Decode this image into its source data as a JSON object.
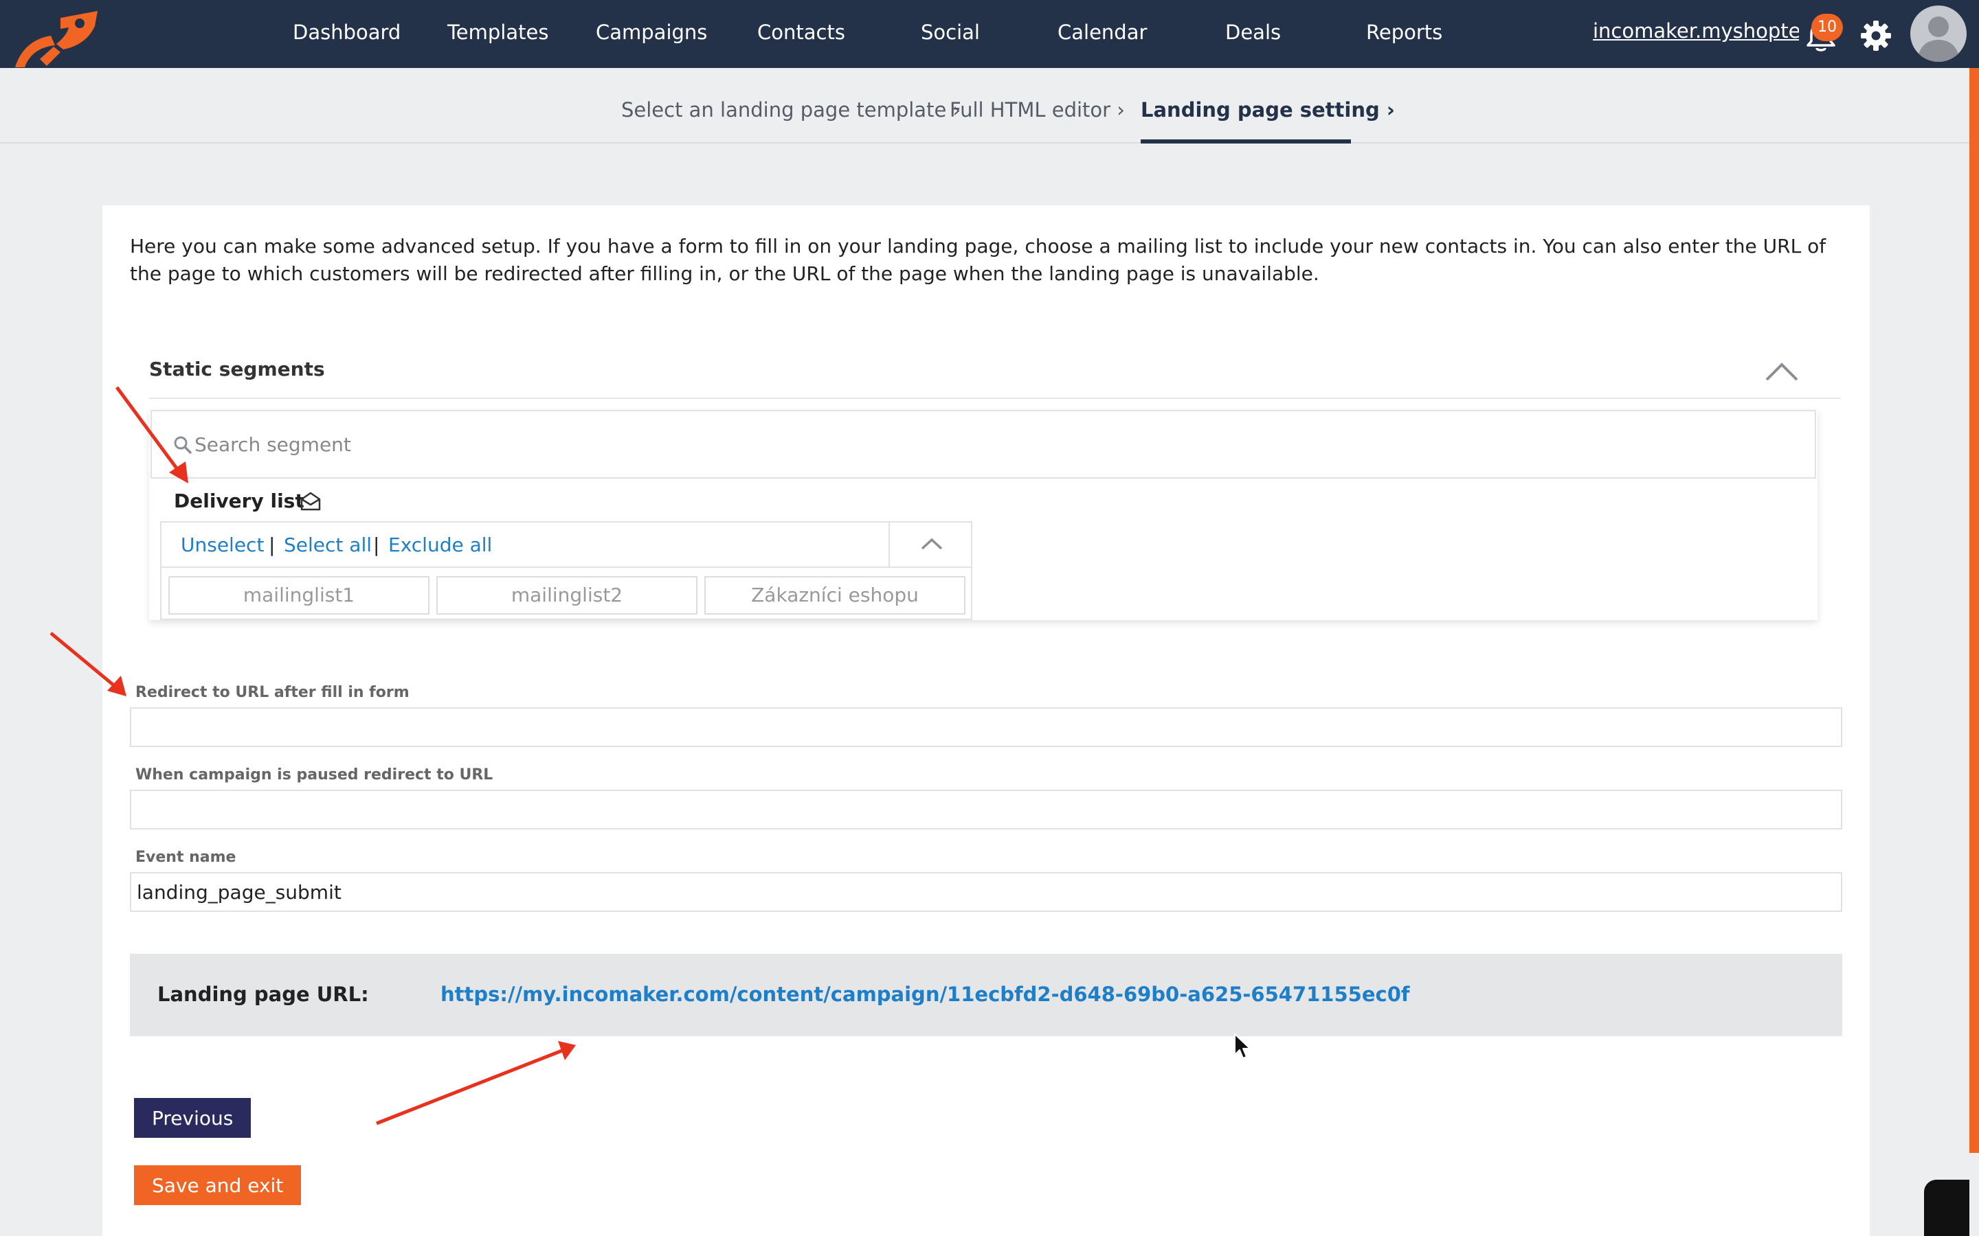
{
  "nav": {
    "items": [
      "Dashboard",
      "Templates",
      "Campaigns",
      "Contacts",
      "Social",
      "Calendar",
      "Deals",
      "Reports"
    ],
    "account": "incomaker.myshopte...",
    "notifications_count": "10"
  },
  "steps": [
    {
      "label": "Select an landing page template",
      "active": false
    },
    {
      "label": "Full HTML editor",
      "active": false
    },
    {
      "label": "Landing page setting",
      "active": true
    }
  ],
  "intro": "Here you can make some advanced setup. If you have a form to fill in on your landing page, choose a mailing list to include your new contacts in. You can also enter the URL of the page to which customers will be redirected after filling in, or the URL of the page when the landing page is unavailable.",
  "segments": {
    "title": "Static segments",
    "search_placeholder": "Search segment",
    "delivery_list_label": "Delivery list",
    "actions": {
      "unselect": "Unselect",
      "select_all": "Select all",
      "exclude_all": "Exclude all",
      "separator": "|"
    },
    "lists": [
      "mailinglist1",
      "mailinglist2",
      "Zákazníci eshopu"
    ]
  },
  "fields": {
    "redirect_label": "Redirect to URL after fill in form",
    "redirect_value": "",
    "paused_label": "When campaign is paused redirect to URL",
    "paused_value": "",
    "event_label": "Event name",
    "event_value": "landing_page_submit"
  },
  "landing": {
    "label": "Landing page URL:",
    "url": "https://my.incomaker.com/content/campaign/11ecbfd2-d648-69b0-a625-65471155ec0f"
  },
  "buttons": {
    "previous": "Previous",
    "save": "Save and exit"
  },
  "colors": {
    "topbar": "#243249",
    "accent": "#f06424",
    "link": "#1e7fc8",
    "annotation_arrow": "#e8321e",
    "previous_button": "#2a2a5e"
  },
  "icons": [
    "logo-icon",
    "bell-icon",
    "gear-icon",
    "avatar-icon",
    "search-icon",
    "envelope-open-icon",
    "chevron-up-icon",
    "chevron-right-icon",
    "cursor-icon"
  ]
}
